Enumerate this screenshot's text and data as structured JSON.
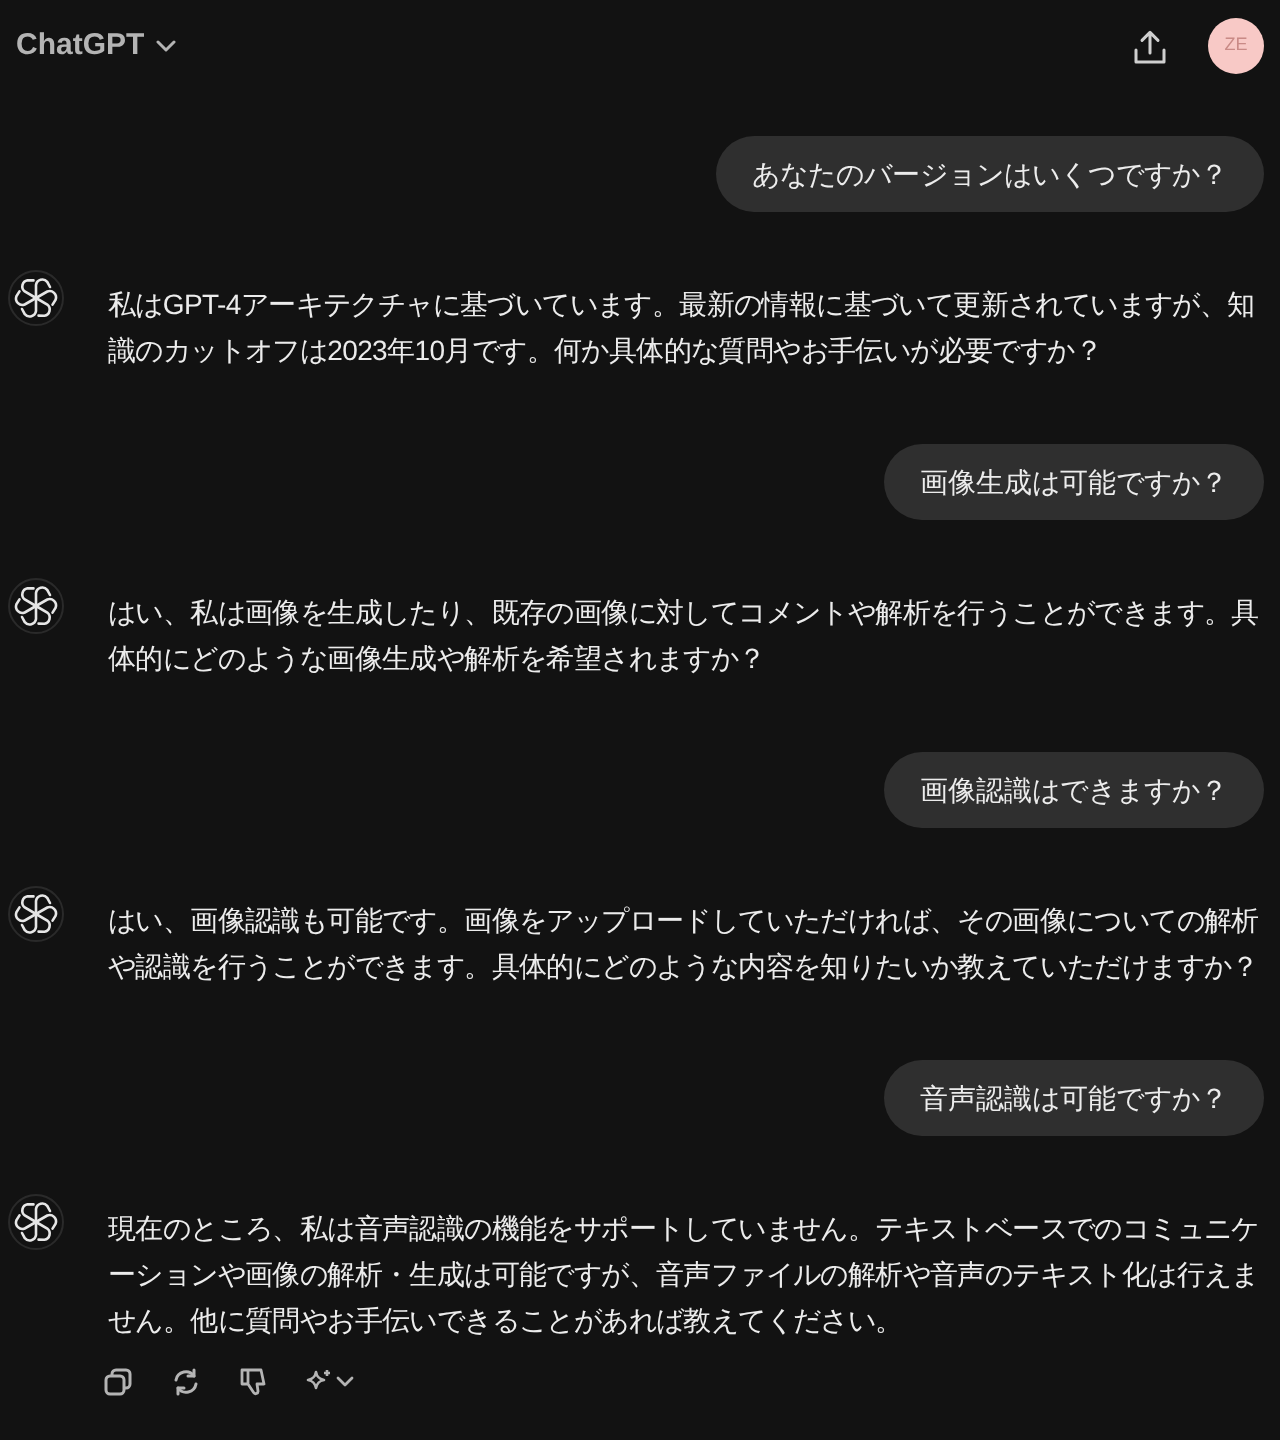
{
  "header": {
    "title": "ChatGPT",
    "avatar_initials": "ZE"
  },
  "messages": [
    {
      "kind": "user",
      "text": "あなたのバージョンはいくつですか？"
    },
    {
      "kind": "assistant",
      "text": "私はGPT-4アーキテクチャに基づいています。最新の情報に基づいて更新されていますが、知識のカットオフは2023年10月です。何か具体的な質問やお手伝いが必要ですか？"
    },
    {
      "kind": "user",
      "text": "画像生成は可能ですか？"
    },
    {
      "kind": "assistant",
      "text": "はい、私は画像を生成したり、既存の画像に対してコメントや解析を行うことができます。具体的にどのような画像生成や解析を希望されますか？"
    },
    {
      "kind": "user",
      "text": "画像認識はできますか？"
    },
    {
      "kind": "assistant",
      "text": "はい、画像認識も可能です。画像をアップロードしていただければ、その画像についての解析や認識を行うことができます。具体的にどのような内容を知りたいか教えていただけますか？"
    },
    {
      "kind": "user",
      "text": "音声認識は可能ですか？"
    },
    {
      "kind": "assistant",
      "text": "現在のところ、私は音声認識の機能をサポートしていません。テキストベースでのコミュニケーションや画像の解析・生成は可能ですが、音声ファイルの解析や音声のテキスト化は行えません。他に質問やお手伝いできることがあれば教えてください。"
    }
  ]
}
